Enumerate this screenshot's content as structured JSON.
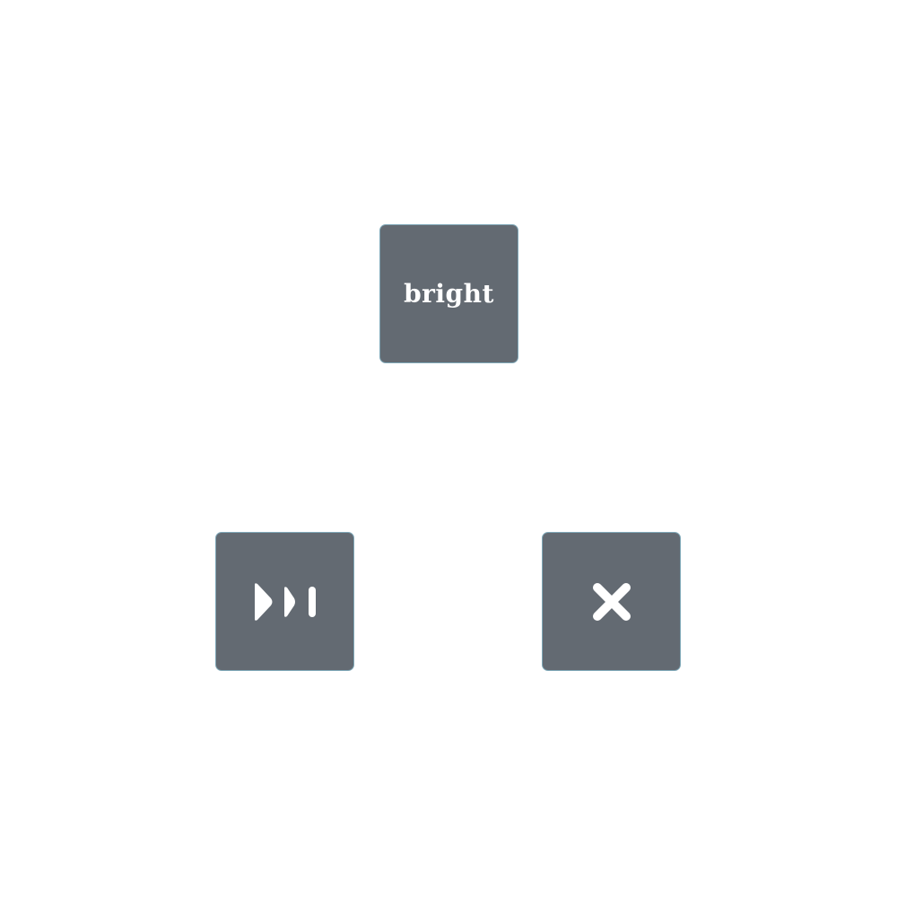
{
  "keys": {
    "bright": {
      "label": "bright"
    },
    "media": {
      "icon": "skip-forward-icon"
    },
    "close": {
      "icon": "close-icon"
    }
  },
  "colors": {
    "background": "#ffffff",
    "key_fill": "#636a72",
    "key_border": "#7fa8b8",
    "foreground": "#ffffff"
  }
}
